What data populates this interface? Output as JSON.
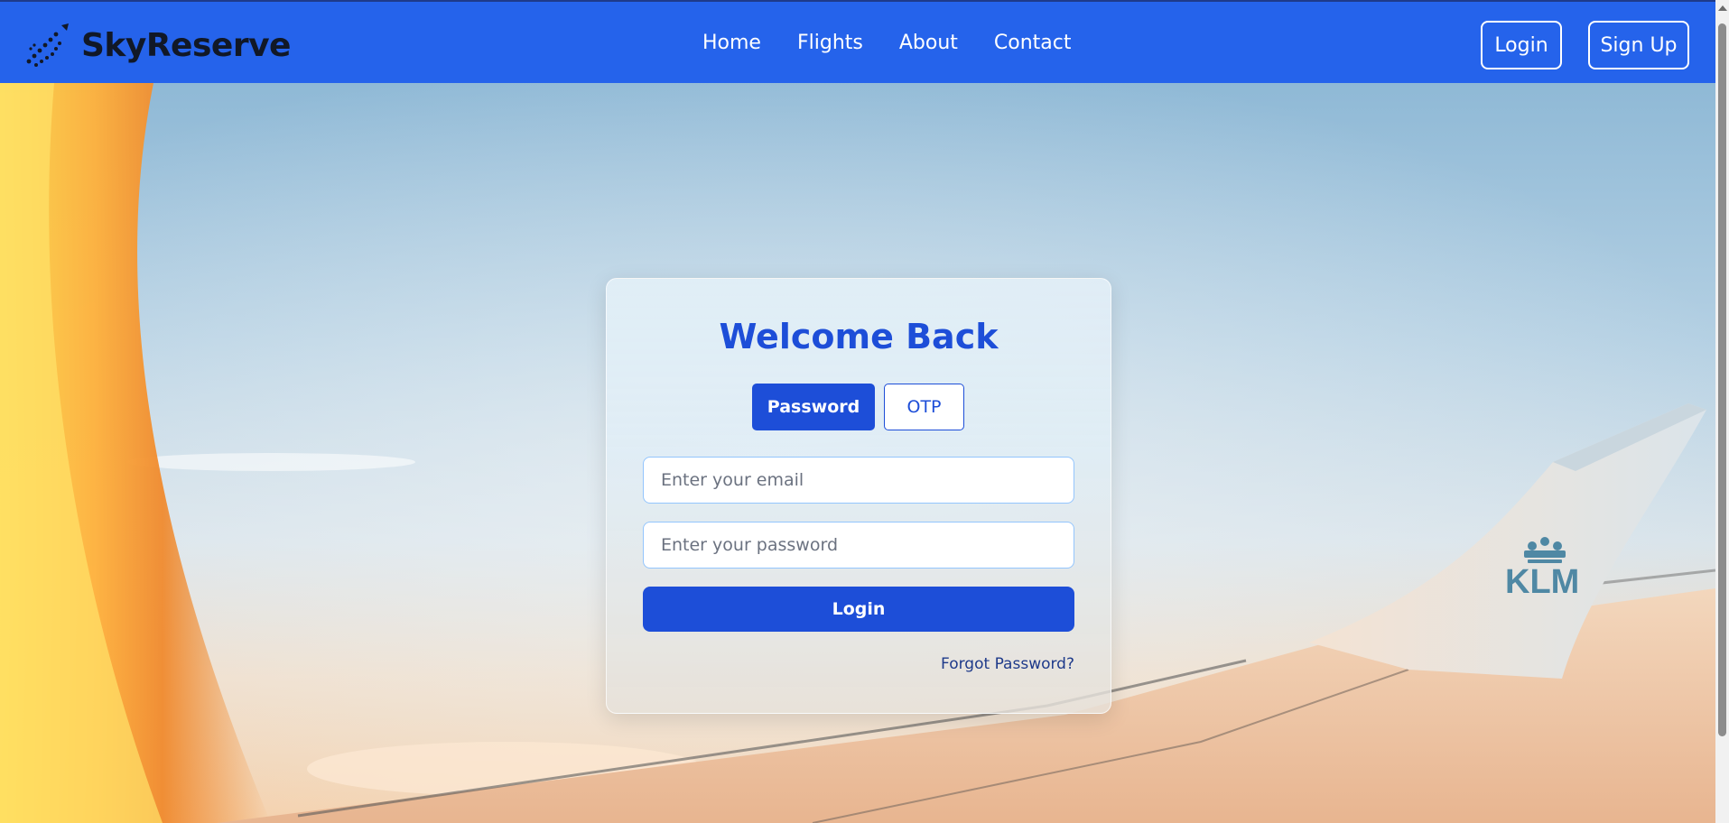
{
  "brand": {
    "name": "SkyReserve",
    "icon": "airplane-trail-icon"
  },
  "nav": {
    "links": [
      "Home",
      "Flights",
      "About",
      "Contact"
    ],
    "login_label": "Login",
    "signup_label": "Sign Up"
  },
  "background": {
    "description_icon": "airplane-wing-photo",
    "wing_logo": "KLM"
  },
  "login_card": {
    "title": "Welcome Back",
    "tabs": {
      "active": "Password",
      "inactive": "OTP"
    },
    "email_placeholder": "Enter your email",
    "password_placeholder": "Enter your password",
    "submit_label": "Login",
    "forgot_label": "Forgot Password?"
  },
  "colors": {
    "primary": "#2563eb",
    "primary_dark": "#1d4ed8",
    "brand_text": "#111827"
  }
}
